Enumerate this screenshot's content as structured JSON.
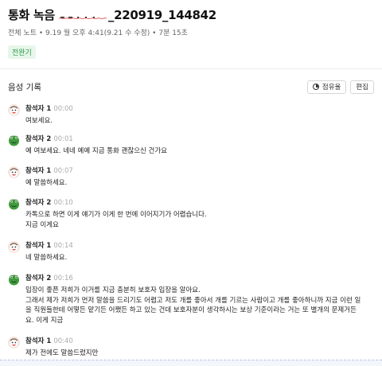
{
  "note": {
    "title_prefix": "통화 녹음",
    "title_suffix": "_220919_144842",
    "meta": "전체 노트 • 9.19 월 오후 4:41(9.21 수 수정) • 7분 15초",
    "tag": "전완기"
  },
  "transcript": {
    "section_title": "음성 기록",
    "share_button": "점유율",
    "edit_button": "편집"
  },
  "messages": [
    {
      "speaker": "참석자 1",
      "time": "00:00",
      "avatar": "person-face-icon",
      "lines": [
        "여보세요."
      ]
    },
    {
      "speaker": "참석자 2",
      "time": "00:01",
      "avatar": "frog-icon",
      "lines": [
        "예 여보세요. 네네 예예 지금 통화 괜찮으신 건가요"
      ]
    },
    {
      "speaker": "참석자 1",
      "time": "00:07",
      "avatar": "person-face-icon",
      "lines": [
        "예 말씀하세요."
      ]
    },
    {
      "speaker": "참석자 2",
      "time": "00:10",
      "avatar": "frog-icon",
      "lines": [
        "카톡으로 하면 이게 얘기가 이게 한 번에 이어지기가 어렵습니다.",
        "지금 이게요"
      ]
    },
    {
      "speaker": "참석자 1",
      "time": "00:14",
      "avatar": "person-face-icon",
      "lines": [
        "네 말씀하세요."
      ]
    },
    {
      "speaker": "참석자 2",
      "time": "00:16",
      "avatar": "frog-icon",
      "lines": [
        "입장이 좋픈 저희가 이거를 지금 충분히 보호자 입장을 알아요.",
        "그래서 제가 저희가 먼저 말씀을 드리기도 어렵고 저도 개를 좋아서 개를 기르는 사람이고 개를 좋아하니까 지금 이런 일",
        "을 직원들한테 어떻든 맡기든 어쨌든 하고 있는 건데 보호자분이 생각하시는 보상 기준이라는 거는 또 별개의 문제거든",
        "요. 이게 지금"
      ]
    },
    {
      "speaker": "참석자 1",
      "time": "00:40",
      "avatar": "person-face-icon",
      "lines": [
        "제가 전에도 말씀드렸지만"
      ]
    }
  ],
  "colors": {
    "accent": "#2a9a48",
    "tag_bg": "#e7f6ea",
    "muted": "#aaaaaa"
  }
}
